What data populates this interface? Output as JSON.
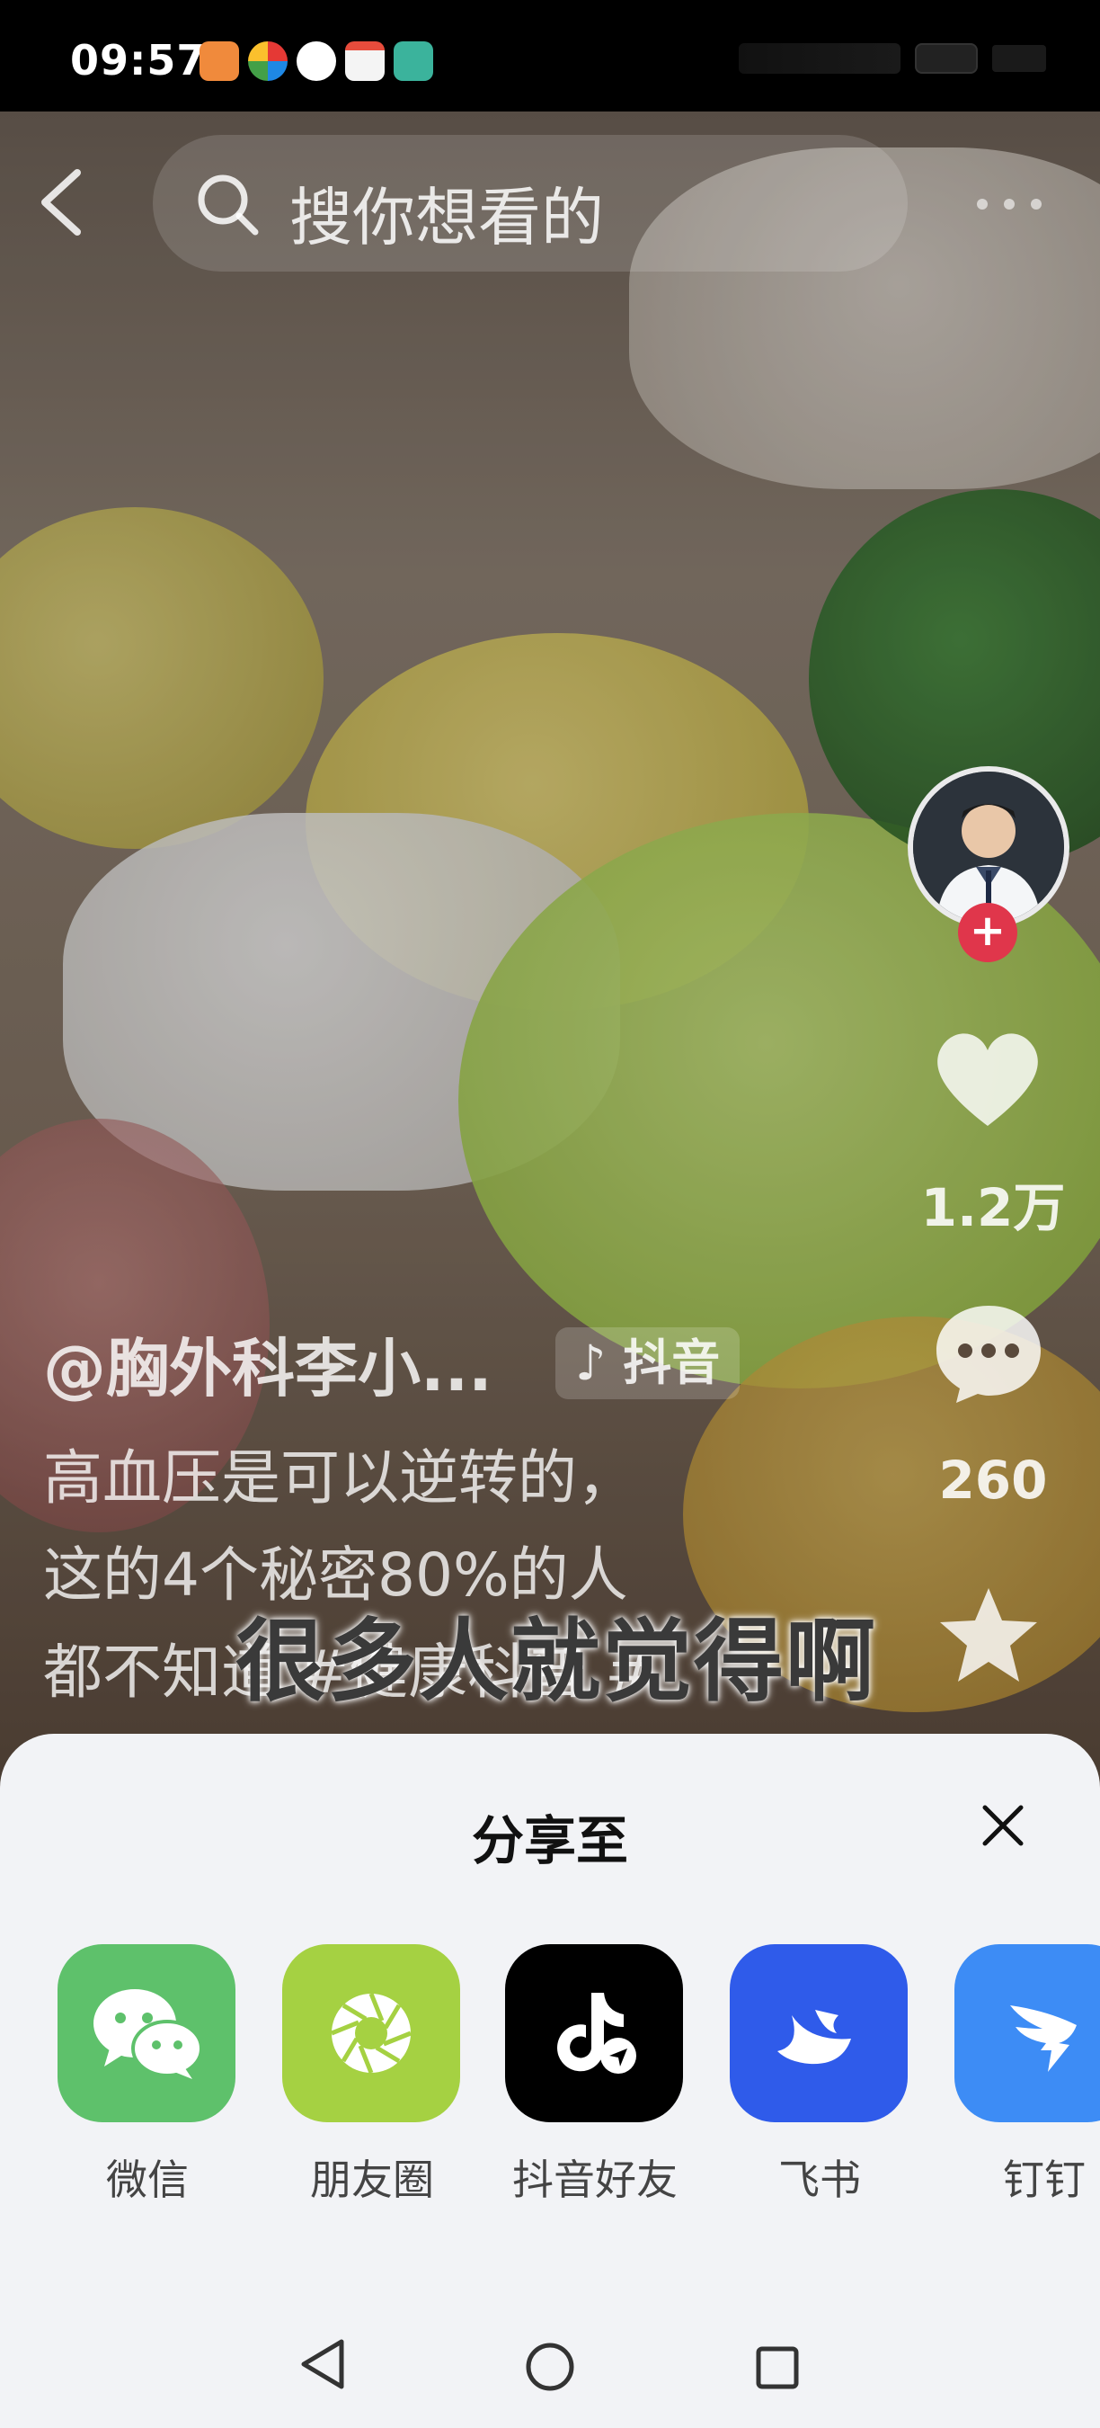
{
  "status_bar": {
    "time": "09:57"
  },
  "top_bar": {
    "search_placeholder": "搜你想看的"
  },
  "actions": {
    "like_count": "1.2万",
    "comment_count": "260"
  },
  "post": {
    "author": "@胸外科李小...",
    "platform_tag": "抖音",
    "description_line1": "高血压是可以逆转的，",
    "description_line2": "这的4个秘密80%的人",
    "description_line3": "都不知道 #健康科普 #",
    "subtitle": "很多人就觉得啊"
  },
  "share_sheet": {
    "title": "分享至",
    "targets": [
      {
        "label": "微信",
        "color": "#5ec16b"
      },
      {
        "label": "朋友圈",
        "color": "#a5d142"
      },
      {
        "label": "抖音好友",
        "color": "#000000"
      },
      {
        "label": "飞书",
        "color": "#2f5bea"
      },
      {
        "label": "钉钉",
        "color": "#3d8cf5"
      }
    ]
  },
  "colors": {
    "follow": "#e0364b",
    "sheet_bg": "#f2f3f6"
  }
}
